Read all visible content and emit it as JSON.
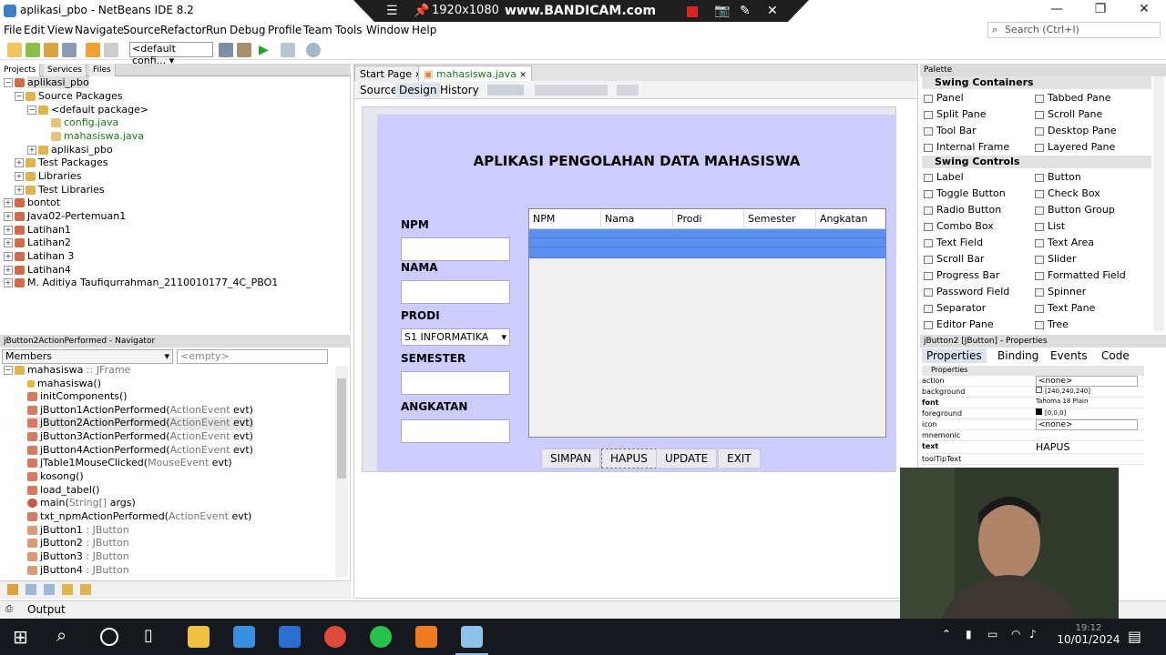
{
  "window": {
    "title": "aplikasi_pbo - NetBeans IDE 8.2"
  },
  "recorder": {
    "resolution": "1920x1080",
    "watermark": "www.BANDICAM.com"
  },
  "menu": [
    "File",
    "Edit",
    "View",
    "Navigate",
    "Source",
    "Refactor",
    "Run",
    "Debug",
    "Profile",
    "Team",
    "Tools",
    "Window",
    "Help"
  ],
  "search": {
    "placeholder": "Search (Ctrl+I)"
  },
  "toolbar": {
    "config": "<default confi..."
  },
  "projects": {
    "tabs": [
      "Projects",
      "Services",
      "Files"
    ],
    "tree": [
      "aplikasi_pbo",
      "Source Packages",
      "<default package>",
      "config.java",
      "mahasiswa.java",
      "aplikasi_pbo",
      "Test Packages",
      "Libraries",
      "Test Libraries",
      "bontot",
      "Java02-Pertemuan1",
      "Latihan1",
      "Latihan2",
      "Latihan 3",
      "Latihan4",
      "M. Aditiya Taufiqurrahman_2110010177_4C_PBO1"
    ]
  },
  "navigator": {
    "title": "jButton2ActionPerformed - Navigator",
    "members": "Members",
    "empty": "<empty>",
    "items": [
      {
        "name": "mahasiswa",
        "type": " :: JFrame"
      },
      {
        "name": "mahasiswa()",
        "type": ""
      },
      {
        "name": "initComponents()",
        "type": ""
      },
      {
        "name": "jButton1ActionPerformed(",
        "type": "ActionEvent",
        "tail": " evt)"
      },
      {
        "name": "jButton2ActionPerformed(",
        "type": "ActionEvent",
        "tail": " evt)"
      },
      {
        "name": "jButton3ActionPerformed(",
        "type": "ActionEvent",
        "tail": " evt)"
      },
      {
        "name": "jButton4ActionPerformed(",
        "type": "ActionEvent",
        "tail": " evt)"
      },
      {
        "name": "jTable1MouseClicked(",
        "type": "MouseEvent",
        "tail": " evt)"
      },
      {
        "name": "kosong()",
        "type": ""
      },
      {
        "name": "load_tabel()",
        "type": ""
      },
      {
        "name": "main(",
        "type": "String[]",
        "tail": " args)"
      },
      {
        "name": "txt_npmActionPerformed(",
        "type": "ActionEvent",
        "tail": " evt)"
      },
      {
        "name": "jButton1",
        "type": " : JButton"
      },
      {
        "name": "jButton2",
        "type": " : JButton"
      },
      {
        "name": "jButton3",
        "type": " : JButton"
      },
      {
        "name": "jButton4",
        "type": " : JButton"
      }
    ]
  },
  "output": "Output",
  "editor": {
    "tabs": [
      "Start Page",
      "mahasiswa.java"
    ],
    "views": [
      "Source",
      "Design",
      "History"
    ]
  },
  "form": {
    "title": "APLIKASI PENGOLAHAN DATA MAHASISWA",
    "labels": [
      "NPM",
      "NAMA",
      "PRODI",
      "SEMESTER",
      "ANGKATAN"
    ],
    "prodi": "S1 INFORMATIKA",
    "columns": [
      "NPM",
      "Nama",
      "Prodi",
      "Semester",
      "Angkatan"
    ],
    "buttons": [
      "SIMPAN",
      "HAPUS",
      "UPDATE",
      "EXIT"
    ]
  },
  "palette": {
    "title": "Palette",
    "cat1": "Swing Containers",
    "containers": [
      "Panel",
      "Tabbed Pane",
      "Split Pane",
      "Scroll Pane",
      "Tool Bar",
      "Desktop Pane",
      "Internal Frame",
      "Layered Pane"
    ],
    "cat2": "Swing Controls",
    "controls": [
      "Label",
      "Button",
      "Toggle Button",
      "Check Box",
      "Radio Button",
      "Button Group",
      "Combo Box",
      "List",
      "Text Field",
      "Text Area",
      "Scroll Bar",
      "Slider",
      "Progress Bar",
      "Formatted Field",
      "Password Field",
      "Spinner",
      "Separator",
      "Text Pane",
      "Editor Pane",
      "Tree"
    ]
  },
  "properties": {
    "title": "jButton2 [JButton] - Properties",
    "tabs": [
      "Properties",
      "Binding",
      "Events",
      "Code"
    ],
    "section": "Properties",
    "rows": [
      {
        "k": "action",
        "v": "<none>"
      },
      {
        "k": "background",
        "v": "[240,240,240]"
      },
      {
        "k": "font",
        "v": "Tahoma 18 Plain"
      },
      {
        "k": "foreground",
        "v": "[0,0,0]"
      },
      {
        "k": "icon",
        "v": "<none>"
      },
      {
        "k": "mnemonic",
        "v": ""
      },
      {
        "k": "text",
        "v": "HAPUS"
      },
      {
        "k": "toolTipText",
        "v": ""
      }
    ]
  },
  "clock": {
    "time": "19:12",
    "date": "10/01/2024"
  },
  "colors": {
    "formBg": "#ccccff",
    "rowSelected": "#5b8ff0"
  }
}
